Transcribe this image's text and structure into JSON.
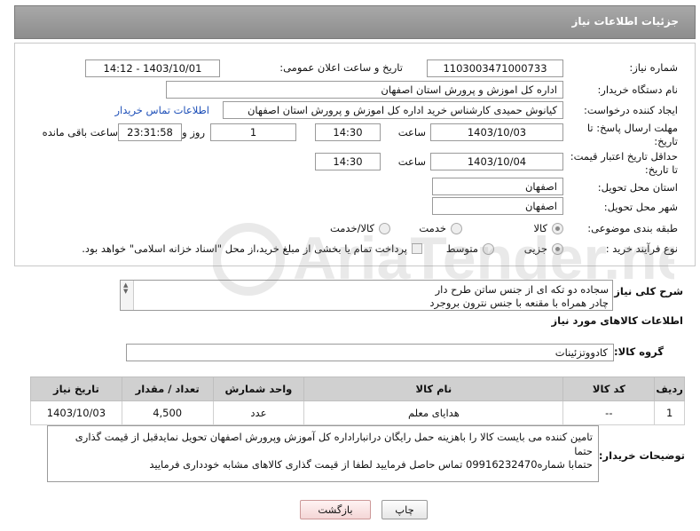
{
  "header": {
    "title": "جزئیات اطلاعات نیاز"
  },
  "fields": {
    "need_number": {
      "label": "شماره نیاز:",
      "value": "1103003471000733"
    },
    "announce_datetime": {
      "label": "تاریخ و ساعت اعلان عمومی:",
      "value": "1403/10/01 - 14:12"
    },
    "buyer_org": {
      "label": "نام دستگاه خریدار:",
      "value": "اداره کل اموزش و پرورش استان اصفهان"
    },
    "requester": {
      "label": "ایجاد کننده درخواست:",
      "value": "کیانوش حمیدی کارشناس خرید اداره کل اموزش و پرورش استان اصفهان",
      "contact_link": "اطلاعات تماس خریدار"
    },
    "reply_deadline": {
      "label": "مهلت ارسال پاسخ: تا تاریخ:",
      "date": "1403/10/03",
      "time_label": "ساعت",
      "time": "14:30",
      "days": "1",
      "days_label": "روز و",
      "remaining": "23:31:58",
      "remaining_label": "ساعت باقی مانده"
    },
    "price_validity": {
      "label": "حداقل تاریخ اعتبار قیمت: تا تاریخ:",
      "date": "1403/10/04",
      "time_label": "ساعت",
      "time": "14:30"
    },
    "delivery_province": {
      "label": "استان محل تحویل:",
      "value": "اصفهان"
    },
    "delivery_city": {
      "label": "شهر محل تحویل:",
      "value": "اصفهان"
    },
    "category": {
      "label": "طبقه بندی موضوعی:",
      "options": [
        "کالا",
        "خدمت",
        "کالا/خدمت"
      ],
      "selected": "کالا"
    },
    "purchase_type": {
      "label": "نوع فرآیند خرید :",
      "options": [
        "جزیی",
        "متوسط"
      ],
      "selected": "جزیی",
      "payment_note": "پرداخت تمام یا بخشی از مبلغ خرید،از محل \"اسناد خزانه اسلامی\" خواهد بود."
    }
  },
  "description": {
    "label": "شرح کلی نیاز:",
    "line1": "سجاده دو تکه ای از جنس ساتن طرح دار",
    "line2": "چادر همراه با مقنعه با جنس نترون بروجرد"
  },
  "goods_section": {
    "title": "اطلاعات کالاهای مورد نیاز"
  },
  "goods_group": {
    "label": "گروه کالا:",
    "value": "کادووتزئینات"
  },
  "items_table": {
    "headers": [
      "ردیف",
      "کد کالا",
      "نام کالا",
      "واحد شمارش",
      "تعداد / مقدار",
      "تاریخ نیاز"
    ],
    "rows": [
      [
        "1",
        "--",
        "هدایای معلم",
        "عدد",
        "4,500",
        "1403/10/03"
      ]
    ]
  },
  "buyer_notes": {
    "label": "توضیحات خریدار:",
    "line1": "تامین کننده می بایست کالا را باهزینه حمل رایگان درانباراداره کل آموزش وپرورش  اصفهان تحویل نمایدقبل از قیمت گذاری حتما",
    "line2": "حتمابا شماره09916232470 تماس حاصل فرمایید  لطفا از قیمت گذاری کالاهای مشابه خودداری فرمایید"
  },
  "buttons": {
    "print": "چاپ",
    "back": "بازگشت"
  },
  "watermark": {
    "text": "AriaTender.net"
  }
}
